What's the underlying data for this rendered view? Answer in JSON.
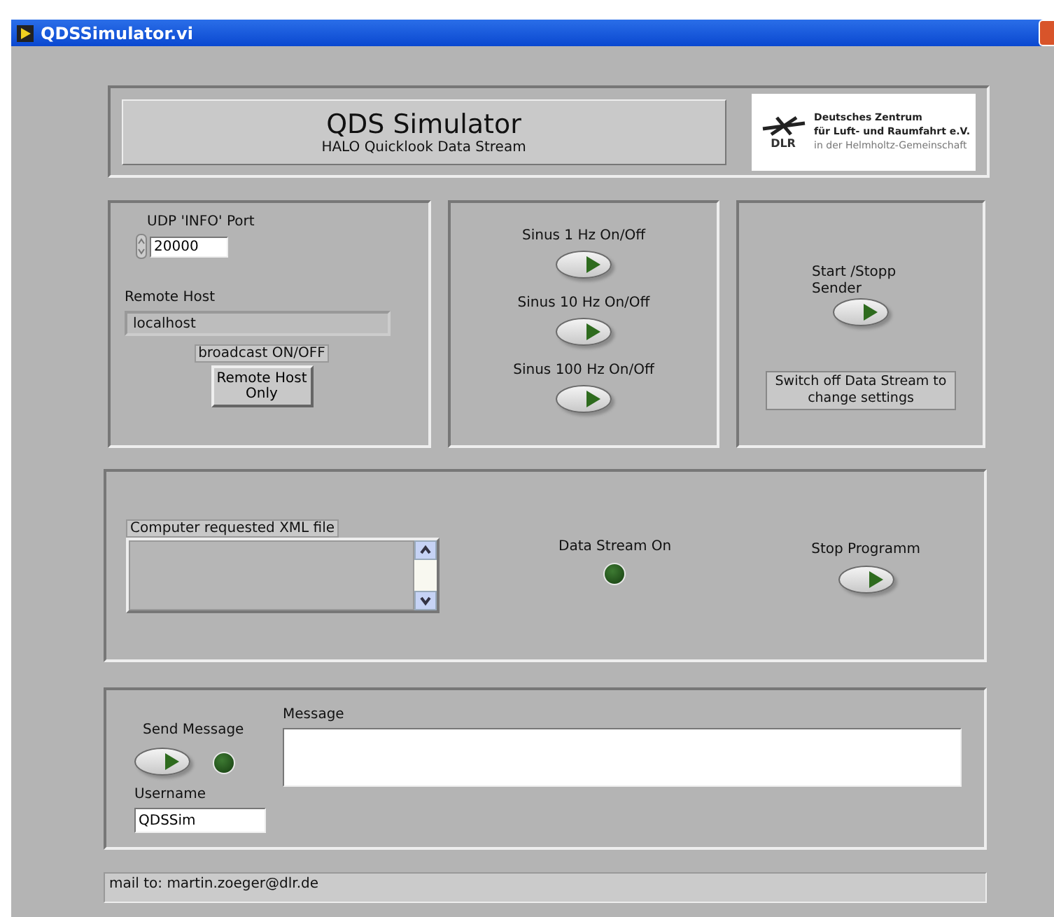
{
  "window": {
    "title": "QDSSimulator.vi"
  },
  "header": {
    "title": "QDS Simulator",
    "subtitle": "HALO Quicklook Data Stream",
    "logo": {
      "mark": "DLR",
      "lines": [
        "Deutsches Zentrum",
        "für Luft- und Raumfahrt e.V.",
        "in der Helmholtz-Gemeinschaft"
      ]
    }
  },
  "network": {
    "port_label": "UDP 'INFO' Port",
    "port_value": "20000",
    "host_label": "Remote Host",
    "host_value": "localhost",
    "broadcast_label": "broadcast ON/OFF",
    "broadcast_button": "Remote Host Only"
  },
  "signals": [
    {
      "label": "Sinus 1 Hz On/Off"
    },
    {
      "label": "Sinus 10 Hz On/Off"
    },
    {
      "label": "Sinus 100 Hz On/Off"
    }
  ],
  "sender": {
    "label": "Start /Stopp Sender",
    "note": "Switch off Data Stream to change settings"
  },
  "status": {
    "xml_label": "Computer requested XML file",
    "stream_label": "Data Stream On",
    "stream_on": false,
    "stop_label": "Stop Programm"
  },
  "messaging": {
    "send_label": "Send Message",
    "sent_led_on": false,
    "message_label": "Message",
    "username_label": "Username",
    "username_value": "QDSSim"
  },
  "footer": {
    "text": "mail to: martin.zoeger@dlr.de"
  }
}
